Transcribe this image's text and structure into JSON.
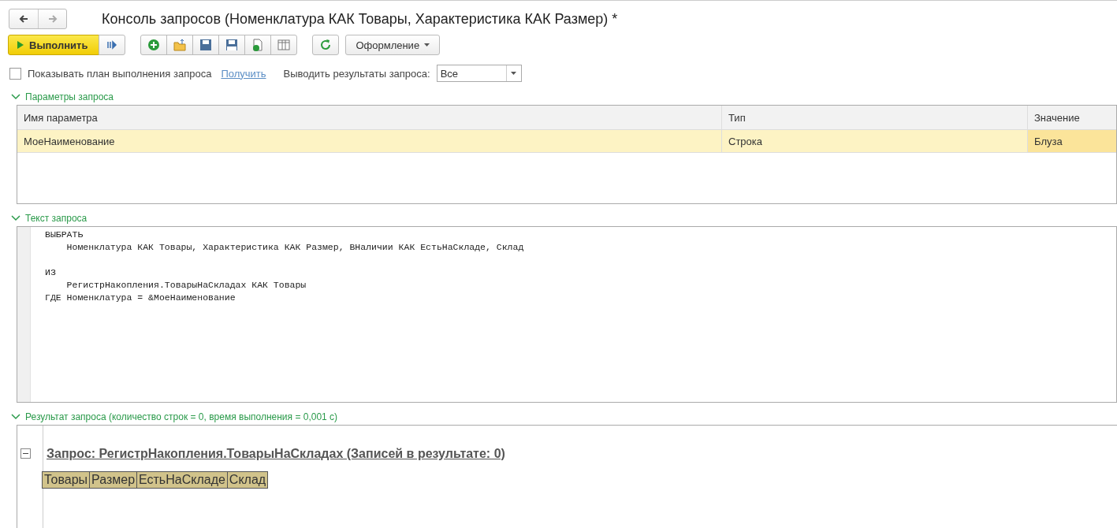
{
  "window": {
    "title": "Консоль запросов (Номенклатура КАК Товары, Характеристика КАК Размер) *"
  },
  "toolbar": {
    "run_button": "Выполнить",
    "design_button": "Оформление"
  },
  "options": {
    "show_plan": {
      "label": "Показывать план выполнения запроса",
      "checked": false
    },
    "get_link": "Получить",
    "output_label": "Выводить результаты запроса:",
    "output_value": "Все"
  },
  "parameters": {
    "title": "Параметры запроса",
    "expanded": true,
    "columns": [
      "Имя параметра",
      "Тип",
      "Значение"
    ],
    "rows": [
      {
        "name": "МоеНаименование",
        "type": "Строка",
        "value": "Блуза",
        "selected": true
      }
    ]
  },
  "query_text": {
    "title": "Текст запроса",
    "expanded": true,
    "lines": [
      {
        "text": "ВЫБРАТЬ",
        "gap_before": false
      },
      {
        "text": "    Номенклатура КАК Товары, Характеристика КАК Размер, ВНаличии КАК ЕстьНаСкладе, Склад",
        "gap_before": false
      },
      {
        "text": "ИЗ",
        "gap_before": true
      },
      {
        "text": "    РегистрНакопления.ТоварыНаСкладах КАК Товары",
        "gap_before": false
      },
      {
        "text": "ГДЕ Номенклатура = &МоеНаименование",
        "gap_before": false
      }
    ]
  },
  "result": {
    "title": "Результат запроса (количество строк = 0, время выполнения = 0,001 с)",
    "expanded": true,
    "heading": "Запрос: РегистрНакопления.ТоварыНаСкладах (Записей в результате: 0)",
    "group_expanded": true,
    "columns": [
      "Товары",
      "Размер",
      "ЕстьНаСкладе",
      "Склад"
    ]
  }
}
